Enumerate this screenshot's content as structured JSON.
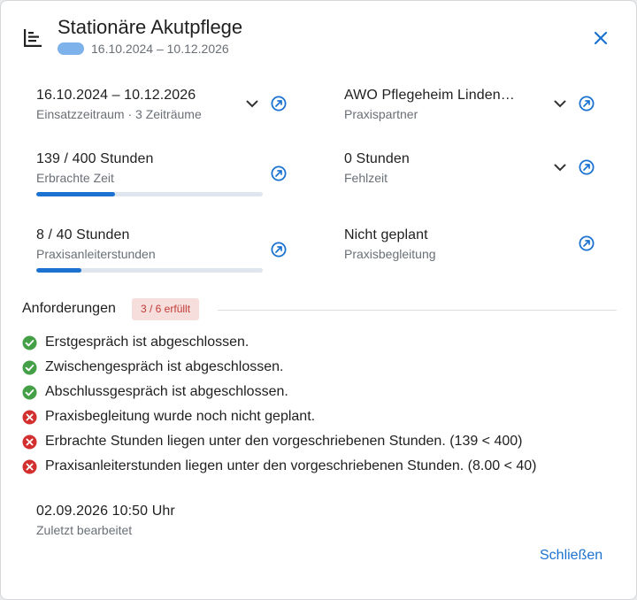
{
  "dialog": {
    "title": "Stationäre Akutpflege",
    "subtitle": "16.10.2024 – 10.12.2026",
    "period_chip_color": "#7db2ea",
    "accent_color": "#1b72d0"
  },
  "fields": {
    "einsatzzeitraum": {
      "value": "16.10.2024 – 10.12.2026",
      "label": "Einsatzzeitraum · 3 Zeiträume"
    },
    "praxispartner": {
      "value": "AWO Pflegeheim Linden…",
      "label": "Praxispartner"
    },
    "erbrachte_zeit": {
      "value": "139 / 400 Stunden",
      "label": "Erbrachte Zeit",
      "progress": 0.3475
    },
    "fehlzeit": {
      "value": "0 Stunden",
      "label": "Fehlzeit"
    },
    "praxisanleiterstunden": {
      "value": "8 / 40 Stunden",
      "label": "Praxisanleiterstunden",
      "progress": 0.2
    },
    "praxisbegleitung": {
      "value": "Nicht geplant",
      "label": "Praxisbegleitung"
    }
  },
  "requirements": {
    "title": "Anforderungen",
    "badge": "3 / 6 erfüllt",
    "items": [
      {
        "text": "Erstgespräch ist abgeschlossen.",
        "status": "ok"
      },
      {
        "text": "Zwischengespräch ist abgeschlossen.",
        "status": "ok"
      },
      {
        "text": "Abschlussgespräch ist abgeschlossen.",
        "status": "ok"
      },
      {
        "text": "Praxisbegleitung wurde noch nicht geplant.",
        "status": "error"
      },
      {
        "text": "Erbrachte Stunden liegen unter den vorgeschriebenen Stunden. (139 < 400)",
        "status": "error"
      },
      {
        "text": "Praxisanleiterstunden liegen unter den vorgeschriebenen Stunden. (8.00 < 40)",
        "status": "error"
      }
    ]
  },
  "last_edit": {
    "value": "02.09.2026 10:50 Uhr",
    "label": "Zuletzt bearbeitet"
  },
  "footer": {
    "close_label": "Schließen"
  },
  "icons": {
    "header": "timeline-list-icon",
    "close": "close-icon",
    "expand": "chevron-down-icon",
    "open": "open-in-new-circle-icon",
    "ok": "check-circle-icon",
    "error": "error-circle-icon"
  },
  "status_colors": {
    "ok": "#43a047",
    "error": "#d32f2f"
  }
}
